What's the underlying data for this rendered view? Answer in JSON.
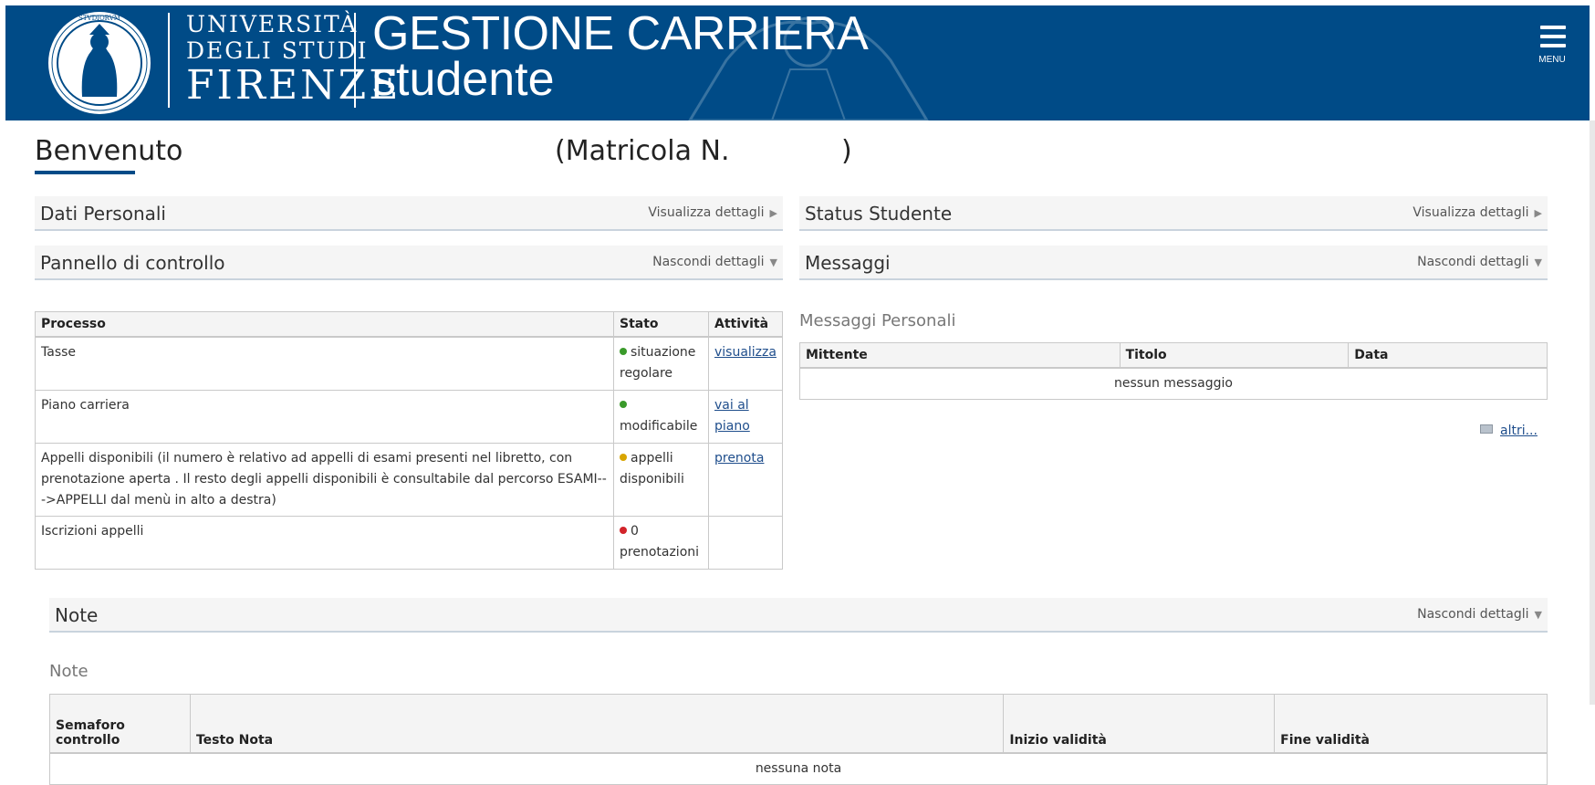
{
  "header": {
    "university_line1": "UNIVERSITÀ",
    "university_line2": "DEGLI STUDI",
    "university_line3": "FIRENZE",
    "app_title_line1": "GESTIONE CARRIERA",
    "app_title_line2": "studente",
    "menu_label": "MENU",
    "brand_color": "#004b87"
  },
  "welcome": {
    "greeting": "Benvenuto",
    "matricola_open": "(Matricola N.",
    "matricola_close": ")"
  },
  "sections": {
    "dati_personali": {
      "title": "Dati Personali",
      "action": "Visualizza dettagli"
    },
    "status_studente": {
      "title": "Status Studente",
      "action": "Visualizza dettagli"
    },
    "pannello": {
      "title": "Pannello di controllo",
      "action": "Nascondi dettagli"
    },
    "messaggi": {
      "title": "Messaggi",
      "action": "Nascondi dettagli"
    },
    "note": {
      "title": "Note",
      "action": "Nascondi dettagli"
    }
  },
  "processi": {
    "headers": {
      "processo": "Processo",
      "stato": "Stato",
      "attivita": "Attività"
    },
    "rows": [
      {
        "processo": "Tasse",
        "stato": "situazione regolare",
        "stato_color": "green",
        "attivita": "visualizza"
      },
      {
        "processo": "Piano carriera",
        "stato": "modificabile",
        "stato_color": "green",
        "attivita_l1": "vai al",
        "attivita_l2": "piano"
      },
      {
        "processo": "Appelli disponibili (il numero è relativo ad appelli di esami presenti nel libretto, con prenotazione aperta . Il resto degli appelli disponibili è consultabile dal percorso ESAMI--->APPELLI dal menù in alto a destra)",
        "stato": "appelli disponibili",
        "stato_color": "yellow",
        "attivita": "prenota"
      },
      {
        "processo": "Iscrizioni appelli",
        "stato": "0 prenotazioni",
        "stato_color": "red",
        "attivita": ""
      }
    ]
  },
  "messaggi_personali": {
    "label": "Messaggi Personali",
    "headers": {
      "mittente": "Mittente",
      "titolo": "Titolo",
      "data": "Data"
    },
    "empty": "nessun messaggio",
    "more_link": "altri..."
  },
  "note": {
    "label": "Note",
    "headers": {
      "semaforo_l1": "Semaforo",
      "semaforo_l2": "controllo",
      "testo": "Testo Nota",
      "inizio": "Inizio validità",
      "fine": "Fine validità"
    },
    "empty": "nessuna nota"
  }
}
